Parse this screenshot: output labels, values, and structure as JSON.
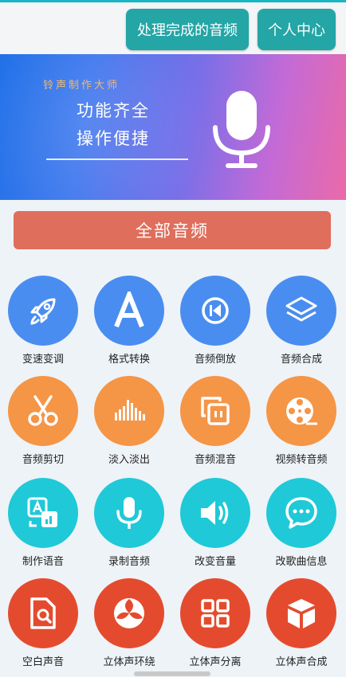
{
  "header": {
    "processed_label": "处理完成的音频",
    "profile_label": "个人中心"
  },
  "banner": {
    "tag": "铃声制作大师",
    "line1": "功能齐全",
    "line2": "操作便捷",
    "icon": "microphone-icon"
  },
  "all_audio_label": "全部音频",
  "colors": {
    "teal": "#24a5a6",
    "blue": "#4a8df0",
    "orange": "#f59546",
    "cyan": "#1fc9d8",
    "red": "#e44b2e",
    "all_audio": "#df6e5c"
  },
  "tools": [
    {
      "label": "变速变调",
      "icon": "rocket-icon"
    },
    {
      "label": "格式转换",
      "icon": "letter-a-icon"
    },
    {
      "label": "音频倒放",
      "icon": "rewind-icon"
    },
    {
      "label": "音频合成",
      "icon": "layers-icon"
    },
    {
      "label": "音频剪切",
      "icon": "scissors-icon"
    },
    {
      "label": "淡入淡出",
      "icon": "waveform-icon"
    },
    {
      "label": "音频混音",
      "icon": "mix-icon"
    },
    {
      "label": "视频转音频",
      "icon": "film-reel-icon"
    },
    {
      "label": "制作语音",
      "icon": "translate-icon"
    },
    {
      "label": "录制音频",
      "icon": "microphone-icon"
    },
    {
      "label": "改变音量",
      "icon": "speaker-icon"
    },
    {
      "label": "改歌曲信息",
      "icon": "chat-bubble-icon"
    },
    {
      "label": "空白声音",
      "icon": "file-search-icon"
    },
    {
      "label": "立体声环绕",
      "icon": "surround-icon"
    },
    {
      "label": "立体声分离",
      "icon": "grid-icon"
    },
    {
      "label": "立体声合成",
      "icon": "cube-icon"
    }
  ]
}
